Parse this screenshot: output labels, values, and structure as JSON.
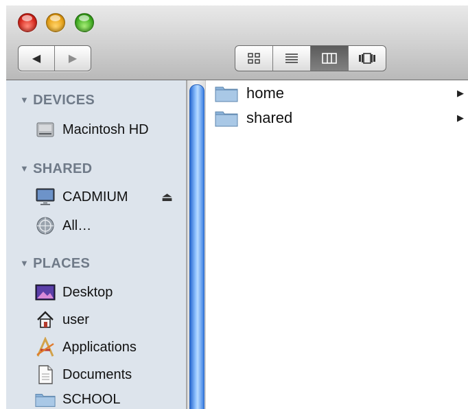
{
  "toolbar": {
    "back_glyph": "◀",
    "forward_glyph": "▶",
    "view_modes": [
      "icon-view",
      "list-view",
      "column-view",
      "coverflow-view"
    ],
    "active_view": "column-view"
  },
  "sidebar": {
    "sections": [
      {
        "title": "DEVICES",
        "items": [
          {
            "label": "Macintosh HD",
            "icon": "hard-drive-icon"
          }
        ]
      },
      {
        "title": "SHARED",
        "items": [
          {
            "label": "CADMIUM",
            "icon": "monitor-icon",
            "eject": "⏏"
          },
          {
            "label": "All…",
            "icon": "network-globe-icon"
          }
        ]
      },
      {
        "title": "PLACES",
        "items": [
          {
            "label": "Desktop",
            "icon": "desktop-icon"
          },
          {
            "label": "user",
            "icon": "home-icon"
          },
          {
            "label": "Applications",
            "icon": "applications-icon"
          },
          {
            "label": "Documents",
            "icon": "documents-icon"
          },
          {
            "label": "SCHOOL",
            "icon": "folder-icon"
          }
        ]
      }
    ]
  },
  "column": {
    "items": [
      {
        "label": "home",
        "icon": "folder-icon"
      },
      {
        "label": "shared",
        "icon": "folder-icon"
      }
    ]
  }
}
